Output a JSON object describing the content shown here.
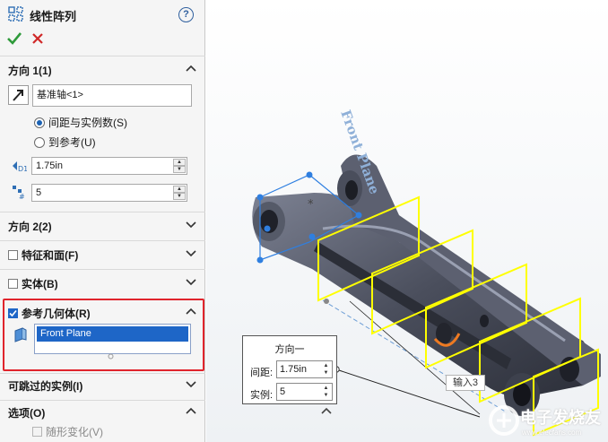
{
  "header": {
    "title": "线性阵列",
    "help": "?"
  },
  "direction1": {
    "title": "方向 1(1)",
    "axis_value": "基准轴<1>",
    "option_spacing": "间距与实例数(S)",
    "option_reference": "到参考(U)",
    "spacing_value": "1.75in",
    "instances_value": "5"
  },
  "sections": {
    "direction2": "方向 2(2)",
    "features_faces": "特征和面(F)",
    "bodies": "实体(B)",
    "ref_geometry": "参考几何体(R)",
    "skip_instances": "可跳过的实例(I)",
    "options": "选项(O)",
    "vary_sketch": "随形变化(V)"
  },
  "ref_geometry_list": [
    "Front Plane"
  ],
  "viewport": {
    "plane_label": "Front Plane",
    "callout": {
      "title": "方向一",
      "spacing_label": "间距:",
      "spacing_value": "1.75in",
      "instances_label": "实例:",
      "instances_value": "5"
    },
    "input_tag": "输入3"
  },
  "watermark": {
    "text": "电子发烧友",
    "url": "www.elecfans.com"
  },
  "colors": {
    "accent": "#1e66c7",
    "highlight": "#e0242c",
    "ok": "#2e9a3a",
    "cancel": "#d02828",
    "pattern": "#ffff00"
  }
}
